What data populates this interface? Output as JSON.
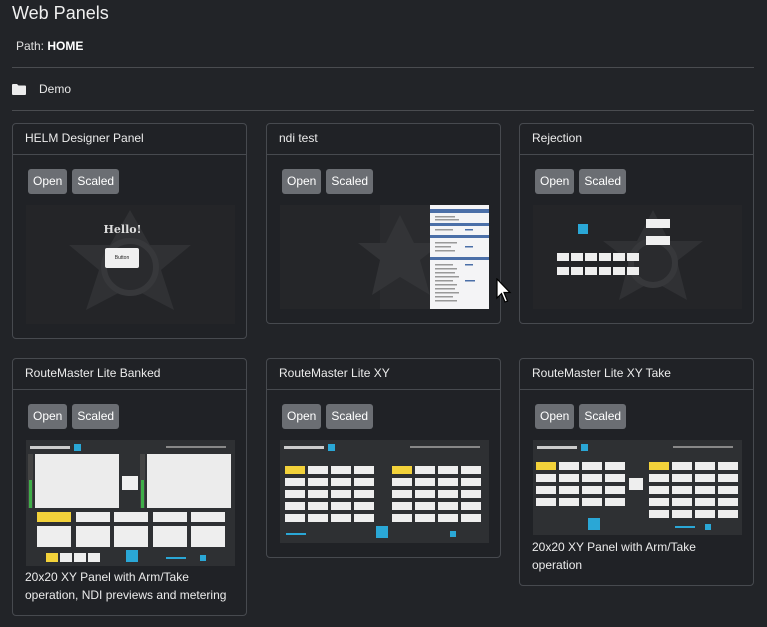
{
  "page": {
    "title": "Web Panels",
    "path_label": "Path:",
    "path_value": "HOME"
  },
  "folders": [
    {
      "name": "Demo",
      "icon": "folder-icon"
    }
  ],
  "buttons": {
    "open": "Open",
    "scaled": "Scaled"
  },
  "panels": [
    {
      "name": "HELM Designer Panel",
      "preview": {
        "heading": "Hello!",
        "button": "Button"
      }
    },
    {
      "name": "ndi test"
    },
    {
      "name": "Rejection"
    },
    {
      "name": "RouteMaster Lite Banked",
      "description": "20x20 XY Panel with Arm/Take operation, NDI previews and metering"
    },
    {
      "name": "RouteMaster Lite XY"
    },
    {
      "name": "RouteMaster Lite XY Take",
      "description": "20x20 XY Panel with Arm/Take operation"
    }
  ],
  "colors": {
    "background": "#222428",
    "button": "#6b6e73",
    "accent_yellow": "#f3d23a",
    "accent_blue": "#2aa7d6"
  }
}
